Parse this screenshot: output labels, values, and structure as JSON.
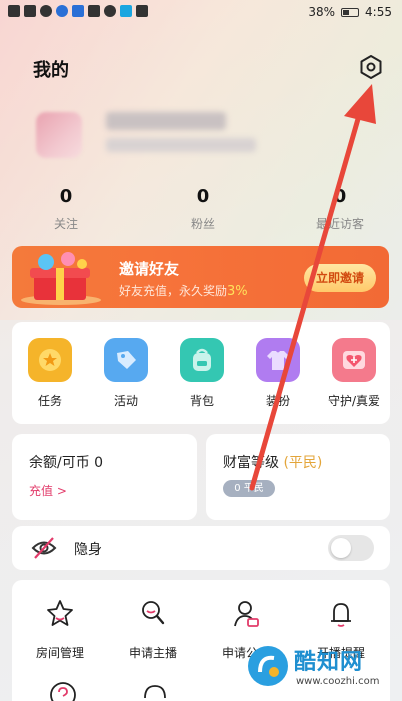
{
  "status": {
    "battery": "38%",
    "time": "4:55"
  },
  "header": {
    "title": "我的"
  },
  "stats": [
    {
      "num": "0",
      "label": "关注"
    },
    {
      "num": "0",
      "label": "粉丝"
    },
    {
      "num": "0",
      "label": "最近访客"
    }
  ],
  "banner": {
    "title": "邀请好友",
    "subtitle_prefix": "好友充值，永久奖励",
    "percent": "3%",
    "button": "立即邀请"
  },
  "grid": [
    {
      "label": "任务",
      "color": "#f5b42a",
      "icon": "star-badge-icon"
    },
    {
      "label": "活动",
      "color": "#57a9f0",
      "icon": "tag-icon"
    },
    {
      "label": "背包",
      "color": "#34c7b2",
      "icon": "backpack-icon"
    },
    {
      "label": "装扮",
      "color": "#b07cf0",
      "icon": "shirt-icon"
    },
    {
      "label": "守护/真爱",
      "color": "#f47a8c",
      "icon": "heart-plus-icon"
    }
  ],
  "balance": {
    "title": "余额/可币 0",
    "link": "充值 >"
  },
  "level": {
    "title": "财富等级",
    "tag": "(平民)",
    "badge": "0 平民"
  },
  "invisible": {
    "label": "隐身"
  },
  "tools": [
    {
      "label": "房间管理",
      "icon": "star-outline-icon"
    },
    {
      "label": "申请主播",
      "icon": "search-badge-icon"
    },
    {
      "label": "申请公会",
      "icon": "user-card-icon"
    },
    {
      "label": "开播提醒",
      "icon": "bell-icon"
    }
  ],
  "watermark": {
    "name": "酷知网",
    "url": "www.coozhi.com"
  }
}
